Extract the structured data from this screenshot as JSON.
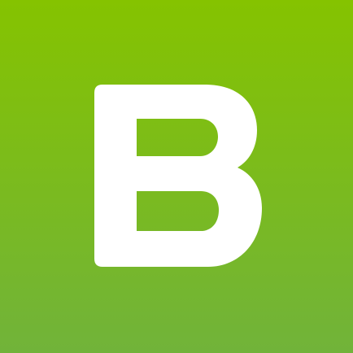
{
  "app": {
    "logo_letter": "B",
    "logo_color": "#ffffff",
    "background_top_color": "#85c300",
    "background_bottom_color": "#71b33a"
  }
}
